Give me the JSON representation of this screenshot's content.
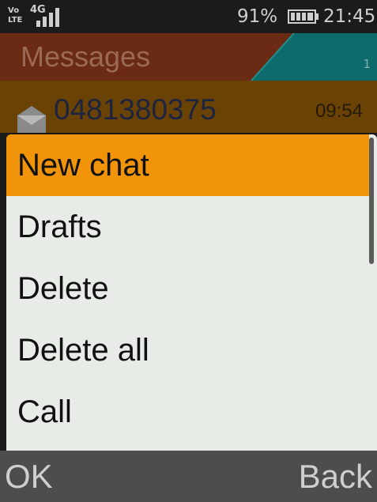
{
  "status_bar": {
    "volte_top": "Vo",
    "volte_bottom": "LTE",
    "network": "4G",
    "battery_percent": "91%",
    "time": "21:45"
  },
  "header": {
    "title": "Messages",
    "count": "1"
  },
  "message": {
    "number": "0481380375",
    "time": "09:54"
  },
  "menu": {
    "items": [
      {
        "label": "New chat",
        "selected": true
      },
      {
        "label": "Drafts",
        "selected": false
      },
      {
        "label": "Delete",
        "selected": false
      },
      {
        "label": "Delete all",
        "selected": false
      },
      {
        "label": "Call",
        "selected": false
      }
    ]
  },
  "softkeys": {
    "left": "OK",
    "right": "Back"
  },
  "colors": {
    "header_bg": "#6b2a13",
    "header_accent": "#0e6b6b",
    "message_row_bg": "#6a4204",
    "menu_bg": "#e8ece7",
    "selected_bg": "#f2940a",
    "softkey_bg": "#4d4d4d"
  },
  "icons": [
    "volte-icon",
    "signal-icon",
    "battery-icon",
    "envelope-icon"
  ]
}
